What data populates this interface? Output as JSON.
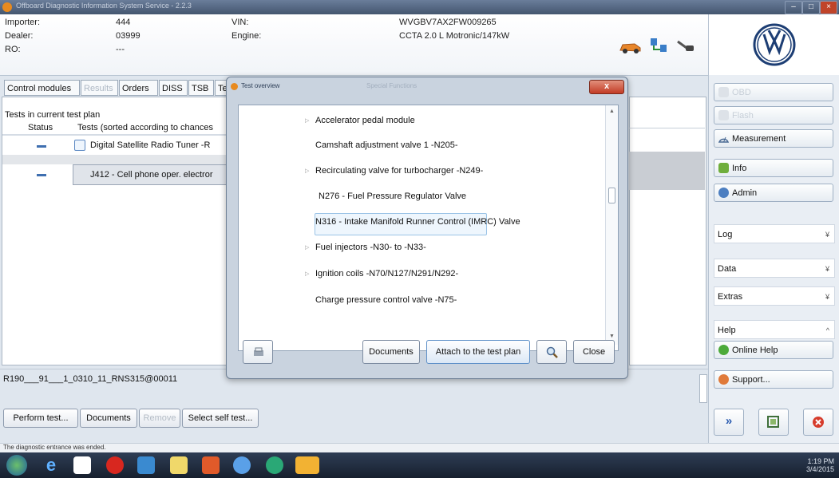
{
  "window": {
    "title": "Offboard Diagnostic Information System Service - 2.2.3"
  },
  "header": {
    "importer_label": "Importer:",
    "importer_value": "444",
    "dealer_label": "Dealer:",
    "dealer_value": "03999",
    "ro_label": "RO:",
    "ro_value": "---",
    "vin_label": "VIN:",
    "vin_value": "WVGBV7AX2FW009265",
    "engine_label": "Engine:",
    "engine_value": "CCTA 2.0 L Motronic/147kW"
  },
  "tabs": [
    {
      "label": "Control modules",
      "enabled": true
    },
    {
      "label": "Results",
      "enabled": false
    },
    {
      "label": "Orders",
      "enabled": true
    },
    {
      "label": "DISS",
      "enabled": true
    },
    {
      "label": "TSB",
      "enabled": true
    },
    {
      "label": "Te",
      "enabled": true
    }
  ],
  "tests": {
    "heading": "Tests in current test plan",
    "col_status": "Status",
    "col_tests": "Tests (sorted according to chances",
    "rows": [
      {
        "label": "Digital Satellite Radio Tuner -R"
      },
      {
        "label": "J412 - Cell phone oper. electror"
      }
    ]
  },
  "ecu_id": "R190___91___1_0310_11_RNS315@00011",
  "bottom_buttons": {
    "perform": "Perform test...",
    "documents": "Documents",
    "remove": "Remove",
    "select_self": "Select self test..."
  },
  "status_text": "The diagnostic entrance was ended.",
  "sidebar": {
    "obd": "OBD",
    "flash": "Flash",
    "measurement": "Measurement",
    "info": "Info",
    "admin": "Admin",
    "log": "Log",
    "data": "Data",
    "extras": "Extras",
    "help": "Help",
    "online_help": "Online Help",
    "support": "Support..."
  },
  "dialog": {
    "title": "Test overview",
    "behind_title": "Special Functions",
    "items": [
      {
        "label": "Accelerator pedal module",
        "expandable": true
      },
      {
        "label": "Camshaft adjustment valve 1 -N205-",
        "expandable": false
      },
      {
        "label": "Recirculating valve for turbocharger -N249-",
        "expandable": true
      },
      {
        "label": "N276 - Fuel Pressure Regulator Valve",
        "expandable": false,
        "selected": true
      },
      {
        "label": "N316 - Intake Manifold Runner Control (IMRC) Valve",
        "expandable": false
      },
      {
        "label": "Fuel injectors -N30- to -N33-",
        "expandable": true
      },
      {
        "label": "Ignition coils -N70/N127/N291/N292-",
        "expandable": true
      },
      {
        "label": "Charge pressure control valve -N75-",
        "expandable": false
      }
    ],
    "documents": "Documents",
    "attach": "Attach to the test plan",
    "close": "Close"
  },
  "taskbar": {
    "time": "1:19 PM",
    "date": "3/4/2015"
  }
}
